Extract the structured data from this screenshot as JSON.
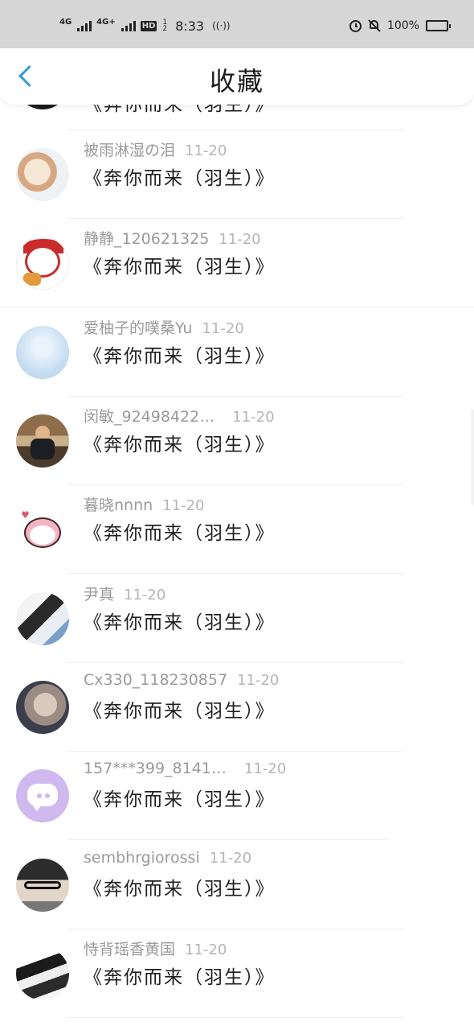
{
  "status_bar": {
    "net1": "4G",
    "net2": "4G+",
    "hd": "HD",
    "hd_nums": [
      "1",
      "2"
    ],
    "time": "8:33",
    "vibrate": "((·))",
    "battery": "100%"
  },
  "header": {
    "title": "收藏"
  },
  "partial_item": {
    "work": "《奔你而来（羽生）》"
  },
  "items": [
    {
      "name": "被雨淋湿の泪",
      "date": "11-20",
      "work": "《奔你而来（羽生）》"
    },
    {
      "name": "静静_120621325",
      "date": "11-20",
      "work": "《奔你而来（羽生）》"
    },
    {
      "name": "爱柚子的噗桑Yu",
      "date": "11-20",
      "work": "《奔你而来（羽生）》"
    },
    {
      "name": "闵敏_92498422…",
      "date": "11-20",
      "work": "《奔你而来（羽生）》"
    },
    {
      "name": "暮晓nnnn",
      "date": "11-20",
      "work": "《奔你而来（羽生）》"
    },
    {
      "name": "尹真",
      "date": "11-20",
      "work": "《奔你而来（羽生）》"
    },
    {
      "name": "Cx330_118230857",
      "date": "11-20",
      "work": "《奔你而来（羽生）》"
    },
    {
      "name": "157***399_8141…",
      "date": "11-20",
      "work": "《奔你而来（羽生）》"
    },
    {
      "name": "sembhrgiorossi",
      "date": "11-20",
      "work": "《奔你而来（羽生）》"
    },
    {
      "name": "恃背瑶香黄国",
      "date": "11-20",
      "work": "《奔你而来（羽生）》"
    }
  ]
}
